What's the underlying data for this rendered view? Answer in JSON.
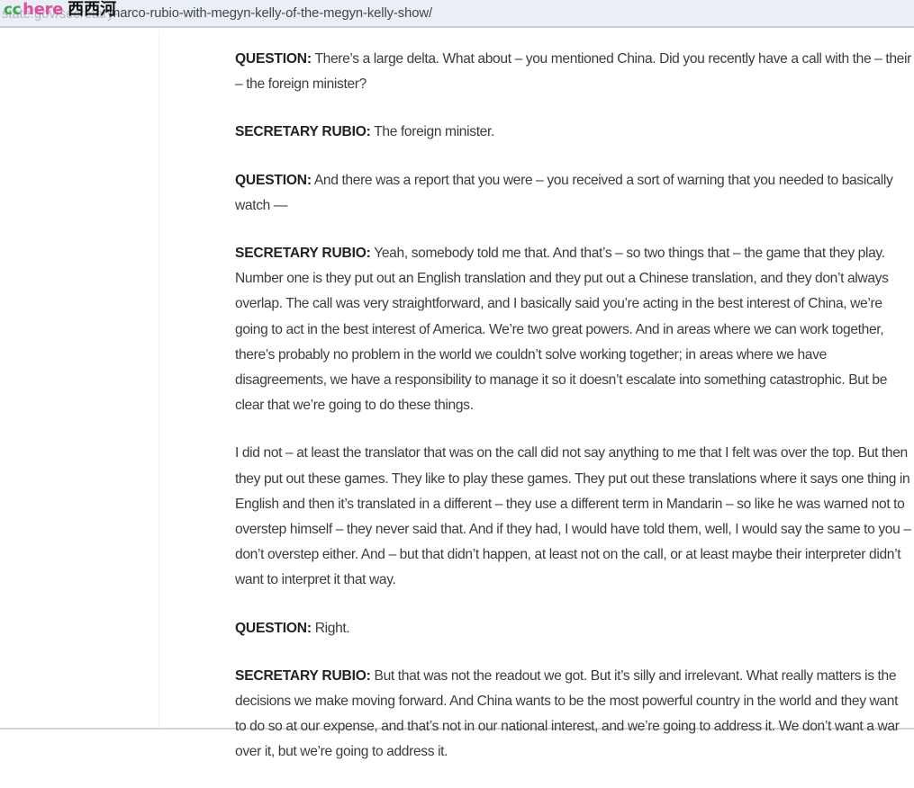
{
  "urlbar": {
    "faint_url": "state.gov/secretary-",
    "url": "marco-rubio-with-megyn-kelly-of-the-megyn-kelly-show/"
  },
  "watermark": {
    "cc": "cc",
    "here": "here",
    "chinese": "西西河",
    "cc_color": "#3fa94b",
    "here_color": "#e0509a",
    "chinese_color": "#111111"
  },
  "transcript": {
    "paragraphs": [
      {
        "speaker": "QUESTION:",
        "text": "  There’s a large delta.  What about – you mentioned China.  Did you recently have a call with the – their – the foreign minister?"
      },
      {
        "speaker": "SECRETARY RUBIO:",
        "text": "  The foreign minister."
      },
      {
        "speaker": "QUESTION:",
        "text": "  And there was a report that you were – you received a sort of warning that you needed to basically watch —"
      },
      {
        "speaker": "SECRETARY RUBIO:",
        "text": "  Yeah, somebody told me that.  And that’s – so two things that – the game that they play.  Number one is they put out an English translation and they put out a Chinese translation, and they don’t always overlap.  The call was very straightforward, and I basically said you’re acting in the best interest of China, we’re going to act in the best interest of America.  We’re two great powers.  And in areas where we can work together, there’s probably no problem in the world we couldn’t solve working together; in areas where we have disagreements, we have a responsibility to manage it so it doesn’t escalate into something catastrophic.  But be clear that we’re going to do these things."
      },
      {
        "speaker": "",
        "text": "I did not – at least the translator that was on the call did not say anything to me that I felt was over the top.  But then they put out these games.  They like to play these games.  They put out these translations where it says one thing in English and then it’s translated in a different – they use a different term in Mandarin – so like he was warned not to overstep himself – they never said that.  And if they had, I would have told them, well, I would say the same to you – don’t overstep either.  And – but that didn’t happen, at least not on the call, or at least maybe their interpreter didn’t want to interpret it that way."
      },
      {
        "speaker": "QUESTION:",
        "text": "  Right."
      },
      {
        "speaker": "SECRETARY RUBIO:",
        "text": "  But that was not the readout we got.  But it’s silly and irrelevant.  What really matters is the decisions we make moving forward.  And China wants to be the most powerful country in the world and they want to do so at our expense, and that’s not in our national interest, and we’re going to address it.  We don’t want a war over it, but we’re going to address it."
      }
    ]
  }
}
